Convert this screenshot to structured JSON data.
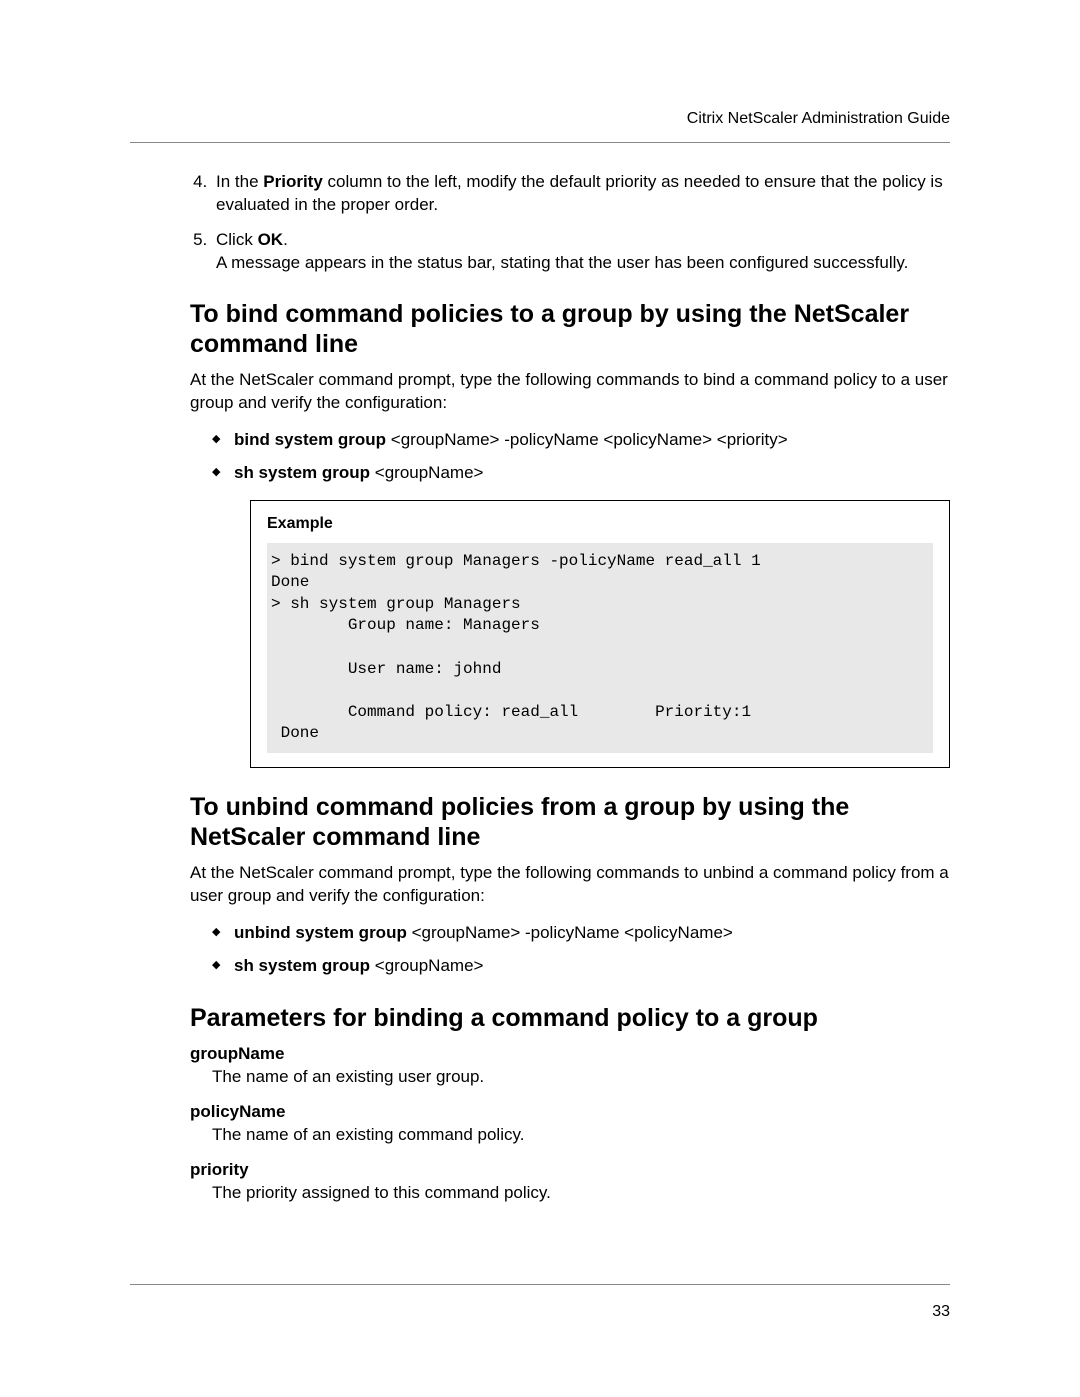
{
  "header": {
    "title": "Citrix NetScaler Administration Guide"
  },
  "ordered": {
    "start": 4,
    "items": [
      {
        "prefix": "In the ",
        "bold1": "Priority",
        "rest": " column to the left, modify the default priority as needed to ensure that the policy is evaluated in the proper order."
      },
      {
        "prefix": "Click ",
        "bold1": "OK",
        "rest": ".",
        "line2": "A message appears in the status bar, stating that the user has been configured successfully."
      }
    ]
  },
  "section1": {
    "heading": "To bind command policies to a group by using the NetScaler command line",
    "para": "At the NetScaler command prompt, type the following commands to bind a command policy to a user group and verify the configuration:",
    "bullets": [
      {
        "bold": "bind system group",
        "rest": " <groupName> -policyName <policyName> <priority>"
      },
      {
        "bold": "sh system group",
        "rest": " <groupName>"
      }
    ]
  },
  "example": {
    "label": "Example",
    "code": "> bind system group Managers -policyName read_all 1\nDone\n> sh system group Managers\n        Group name: Managers\n\n        User name: johnd\n\n        Command policy: read_all        Priority:1\n Done"
  },
  "section2": {
    "heading": "To unbind command policies from a group by using the NetScaler command line",
    "para": "At the NetScaler command prompt, type the following commands to unbind a command policy from a user group and verify the configuration:",
    "bullets": [
      {
        "bold": "unbind system group",
        "rest": " <groupName> -policyName <policyName>"
      },
      {
        "bold": "sh system group",
        "rest": " <groupName>"
      }
    ]
  },
  "section3": {
    "heading": "Parameters for binding a command policy to a group",
    "params": [
      {
        "term": "groupName",
        "desc": "The name of an existing user group."
      },
      {
        "term": "policyName",
        "desc": "The name of an existing command policy."
      },
      {
        "term": "priority",
        "desc": "The priority assigned to this command policy."
      }
    ]
  },
  "pageNumber": "33"
}
